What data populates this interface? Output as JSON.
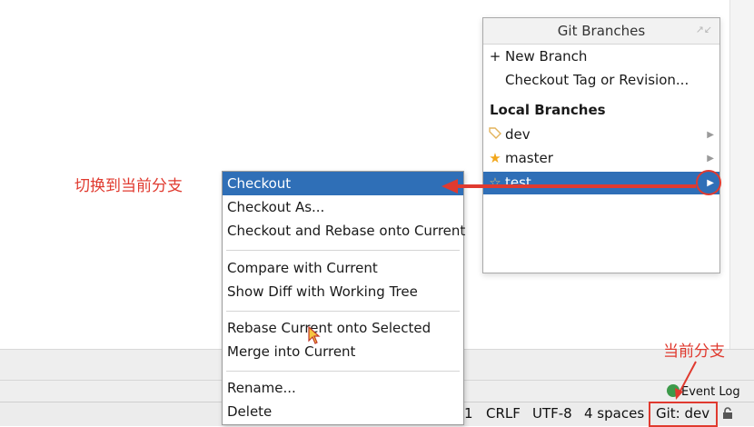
{
  "popup": {
    "title": "Git Branches",
    "new_branch": "New Branch",
    "checkout_tag": "Checkout Tag or Revision...",
    "local_branches_title": "Local Branches",
    "branches": [
      {
        "name": "dev",
        "icon": "tag-icon"
      },
      {
        "name": "master",
        "icon": "star-filled-icon"
      },
      {
        "name": "test",
        "icon": "star-outline-icon",
        "selected": true
      }
    ]
  },
  "submenu": {
    "items": [
      "Checkout",
      "Checkout As...",
      "Checkout and Rebase onto Current",
      "Compare with Current",
      "Show Diff with Working Tree",
      "Rebase Current onto Selected",
      "Merge into Current",
      "Rename...",
      "Delete"
    ]
  },
  "status_bar": {
    "line_num": "1",
    "line_sep": "CRLF",
    "encoding": "UTF-8",
    "indent": "4 spaces",
    "git_branch": "Git: dev",
    "event_log": "Event Log"
  },
  "annotations": {
    "switch_label": "切换到当前分支",
    "current_label": "当前分支"
  },
  "colors": {
    "selection": "#2f6fb7",
    "annotation": "#e03a2f"
  }
}
